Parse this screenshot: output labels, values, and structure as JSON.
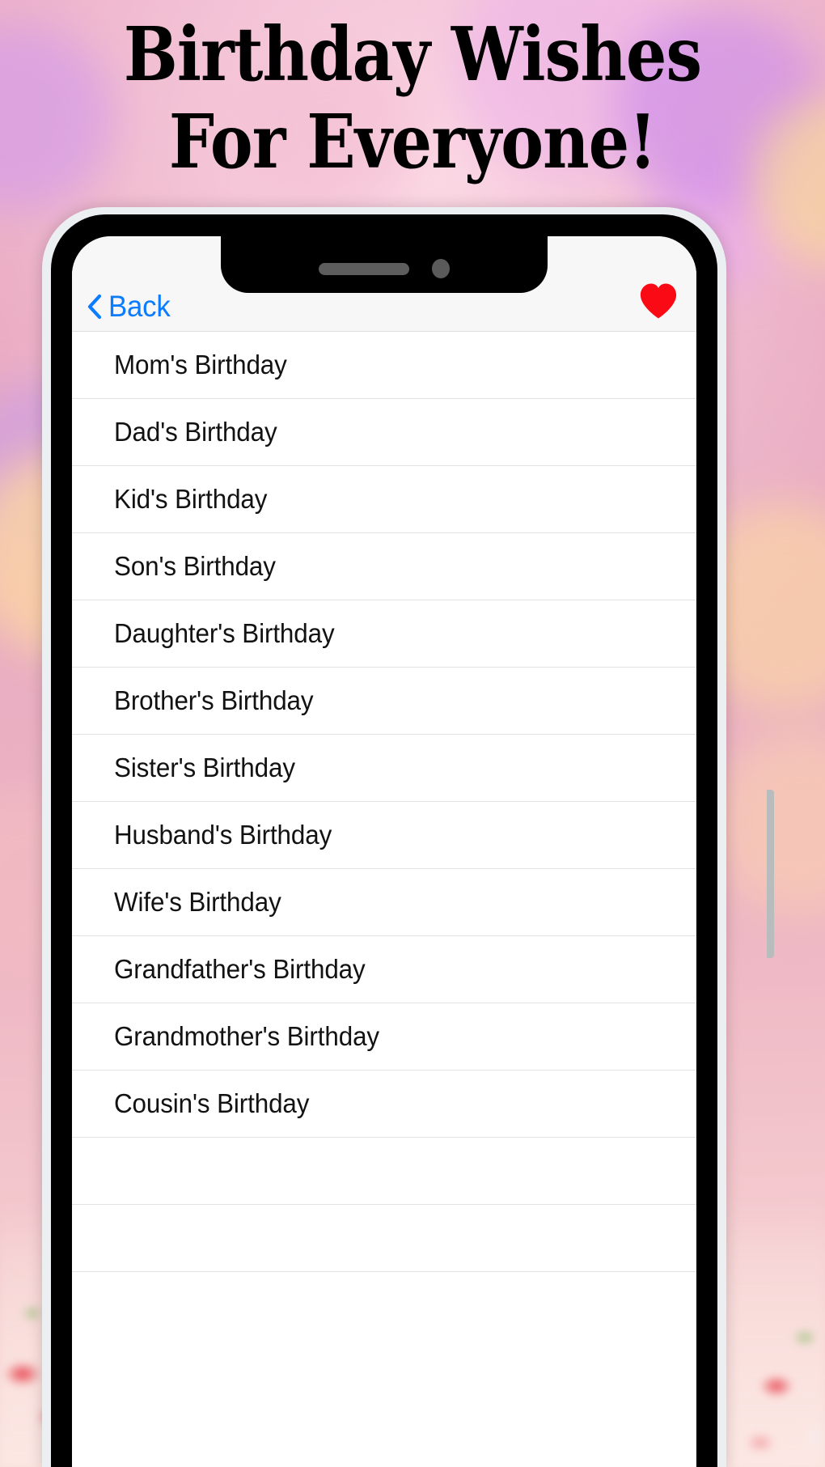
{
  "poster": {
    "headline": "Birthday Wishes\nFor Everyone!",
    "background_colors": {
      "pink": "#e9a8c3",
      "purple": "#cf8fe8",
      "peach": "#fad3a8",
      "cream": "#f8e3df"
    }
  },
  "phone": {
    "frame_color": "#000000",
    "bezel_color": "#eceff1",
    "notch": {
      "speaker_name": "earpiece-speaker",
      "camera_name": "front-camera"
    },
    "side_buttons": [
      "silence-switch",
      "volume-up",
      "volume-down",
      "power"
    ]
  },
  "app": {
    "navbar": {
      "back_label": "Back",
      "back_color": "#0a7cff",
      "favorite_icon": "heart-icon",
      "favorite_color": "#fa0a14",
      "background": "#f7f7f7"
    },
    "list": {
      "items": [
        {
          "label": "Mom's Birthday"
        },
        {
          "label": "Dad's Birthday"
        },
        {
          "label": "Kid's Birthday"
        },
        {
          "label": "Son's Birthday"
        },
        {
          "label": "Daughter's Birthday"
        },
        {
          "label": "Brother's Birthday"
        },
        {
          "label": "Sister's Birthday"
        },
        {
          "label": "Husband's Birthday"
        },
        {
          "label": "Wife's Birthday"
        },
        {
          "label": "Grandfather's Birthday"
        },
        {
          "label": "Grandmother's Birthday"
        },
        {
          "label": "Cousin's Birthday"
        },
        {
          "label": ""
        },
        {
          "label": ""
        }
      ]
    }
  }
}
